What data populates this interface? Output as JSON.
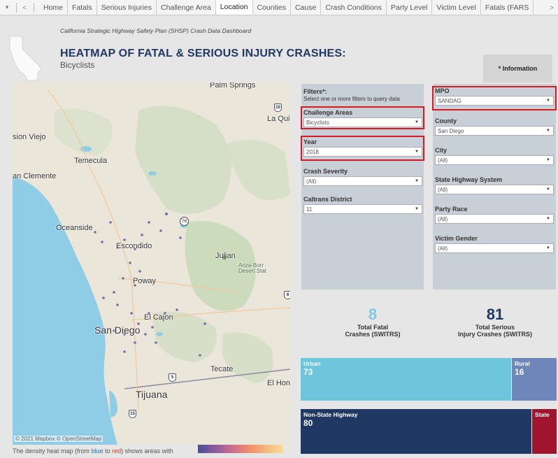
{
  "tabs": {
    "items": [
      "Home",
      "Fatals",
      "Serious Injuries",
      "Challenge Area",
      "Location",
      "Counties",
      "Cause",
      "Crash Conditions",
      "Party Level",
      "Victim Level",
      "Fatals (FARS"
    ],
    "active": "Location",
    "nav_dropdown": "▾",
    "nav_back": "<",
    "nav_forward": ">"
  },
  "header": {
    "dashboard_name": "California Strategic Highway Safety Plan (SHSP) Crash Data Dashboard",
    "title": "HEATMAP OF FATAL & SERIOUS INJURY CRASHES:",
    "subtitle": "Bicyclists",
    "info_button": "* Information"
  },
  "map": {
    "labels": {
      "palm_springs": "Palm Springs",
      "la_quinta": "La Quir",
      "mission_viejo": "sion Viejo",
      "temecula": "Temecula",
      "san_clemente": "an Clemente",
      "oceanside": "Oceanside",
      "escondido": "Escondido",
      "julian": "Julian",
      "anza_borrego": "Anza-Borr\nDesert Stat",
      "poway": "Poway",
      "el_cajon": "El Cajon",
      "san_diego": "San Diego",
      "tecate": "Tecate",
      "el_hongo": "El Hon",
      "tijuana": "Tijuana"
    },
    "shields": {
      "r76": "76",
      "i10": "10",
      "i15": "15",
      "i8": "8",
      "r5": "5"
    },
    "copyright": "© 2021 Mapbox © OpenStreetMap",
    "caption_before": "The density heat map (from ",
    "caption_blue": "blue",
    "caption_mid": " to ",
    "caption_red": "red",
    "caption_after": ") shows areas with",
    "heat_legend_colors": [
      "#4b4d93",
      "#8c5b9d",
      "#c86e8e",
      "#ee8d6c",
      "#f6b77b",
      "#f7de9c"
    ]
  },
  "filters": {
    "heading": "Filters*:",
    "note": "Select one or more filters to query data",
    "challenge_areas": {
      "label": "Challenge Areas",
      "value": "Bicyclists"
    },
    "year": {
      "label": "Year",
      "value": "2018"
    },
    "crash_severity": {
      "label": "Crash Severity",
      "value": "(All)"
    },
    "caltrans_district": {
      "label": "Caltrans District",
      "value": "11"
    },
    "mpo": {
      "label": "MPO",
      "value": "SANDAG"
    },
    "county": {
      "label": "County",
      "value": "San Diego"
    },
    "city": {
      "label": "City",
      "value": "(All)"
    },
    "state_highway_system": {
      "label": "State Highway System",
      "value": "(All)"
    },
    "party_race": {
      "label": "Party Race",
      "value": "(All)"
    },
    "victim_gender": {
      "label": "Victim Gender",
      "value": "(All)"
    }
  },
  "kpis": {
    "fatal": {
      "value": "8",
      "label_line1": "Total Fatal",
      "label_line2": "Crashes (SWITRS)",
      "color": "#7ec8e3"
    },
    "serious": {
      "value": "81",
      "label_line1": "Total Serious",
      "label_line2": "Injury Crashes (SWITRS)",
      "color": "#1f3864"
    }
  },
  "treemap_area": {
    "urban": {
      "label": "Urban",
      "value": "73",
      "color": "#6ec6dc"
    },
    "rural": {
      "label": "Rural",
      "value": "16",
      "color": "#6e86ba"
    }
  },
  "treemap_highway": {
    "non_state": {
      "label": "Non-State Highway",
      "value": "80",
      "color": "#1f3864"
    },
    "state": {
      "label": "State",
      "value": "",
      "color": "#a0142e"
    }
  },
  "colors": {
    "highlight": "#d71920",
    "title": "#1f3864"
  }
}
